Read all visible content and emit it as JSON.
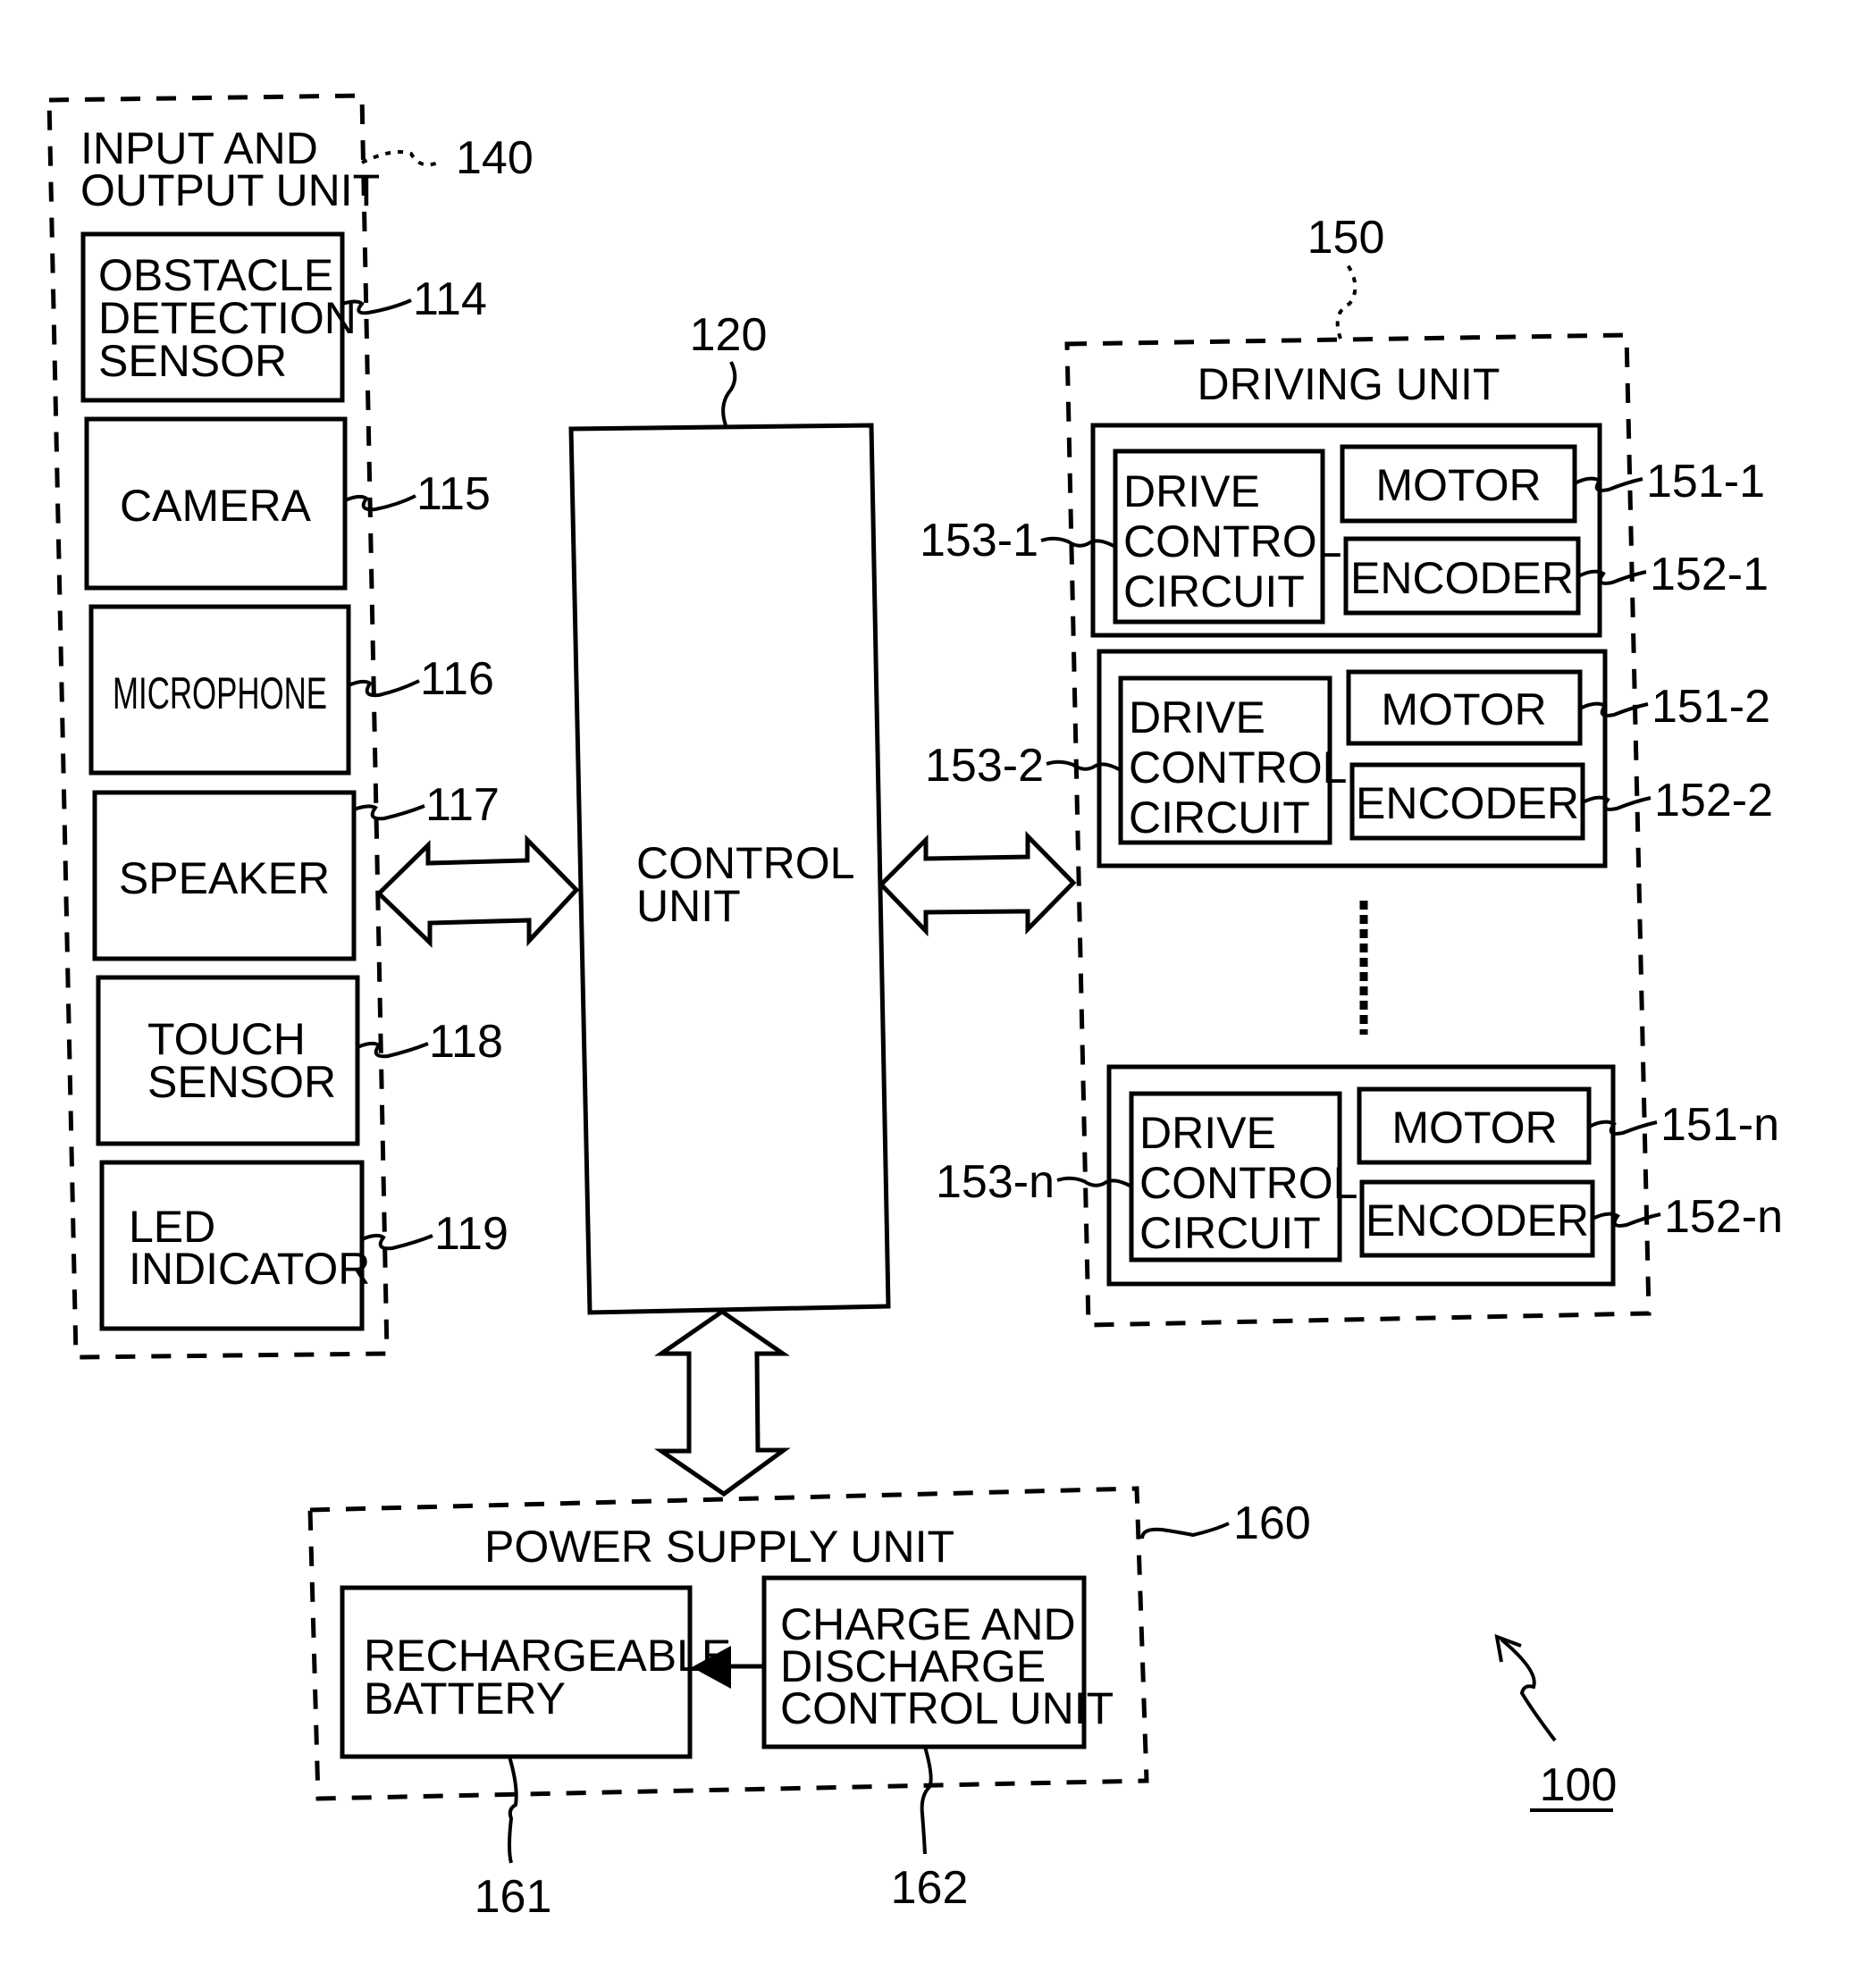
{
  "figure": {
    "reference": "100",
    "io_unit": {
      "ref": "140",
      "title_lines": [
        "INPUT AND",
        "OUTPUT UNIT"
      ],
      "components": [
        {
          "ref": "114",
          "lines": [
            "OBSTACLE",
            "DETECTION",
            "SENSOR"
          ]
        },
        {
          "ref": "115",
          "lines": [
            "CAMERA"
          ]
        },
        {
          "ref": "116",
          "lines": [
            "MICROPHONE"
          ]
        },
        {
          "ref": "117",
          "lines": [
            "SPEAKER"
          ]
        },
        {
          "ref": "118",
          "lines": [
            "TOUCH",
            "SENSOR"
          ]
        },
        {
          "ref": "119",
          "lines": [
            "LED",
            "INDICATOR"
          ]
        }
      ]
    },
    "control_unit": {
      "ref": "120",
      "lines": [
        "CONTROL",
        "UNIT"
      ]
    },
    "driving_unit": {
      "ref": "150",
      "title": "DRIVING UNIT",
      "groups": [
        {
          "circuit_ref": "153-1",
          "motor_ref": "151-1",
          "encoder_ref": "152-1"
        },
        {
          "circuit_ref": "153-2",
          "motor_ref": "151-2",
          "encoder_ref": "152-2"
        },
        {
          "circuit_ref": "153-n",
          "motor_ref": "151-n",
          "encoder_ref": "152-n"
        }
      ],
      "circuit_lines": [
        "DRIVE",
        "CONTROL",
        "CIRCUIT"
      ],
      "motor_label": "MOTOR",
      "encoder_label": "ENCODER"
    },
    "power_unit": {
      "ref": "160",
      "title": "POWER SUPPLY UNIT",
      "battery": {
        "ref": "161",
        "lines": [
          "RECHARGEABLE",
          "BATTERY"
        ]
      },
      "charge_control": {
        "ref": "162",
        "lines": [
          "CHARGE AND",
          "DISCHARGE",
          "CONTROL UNIT"
        ]
      }
    }
  }
}
